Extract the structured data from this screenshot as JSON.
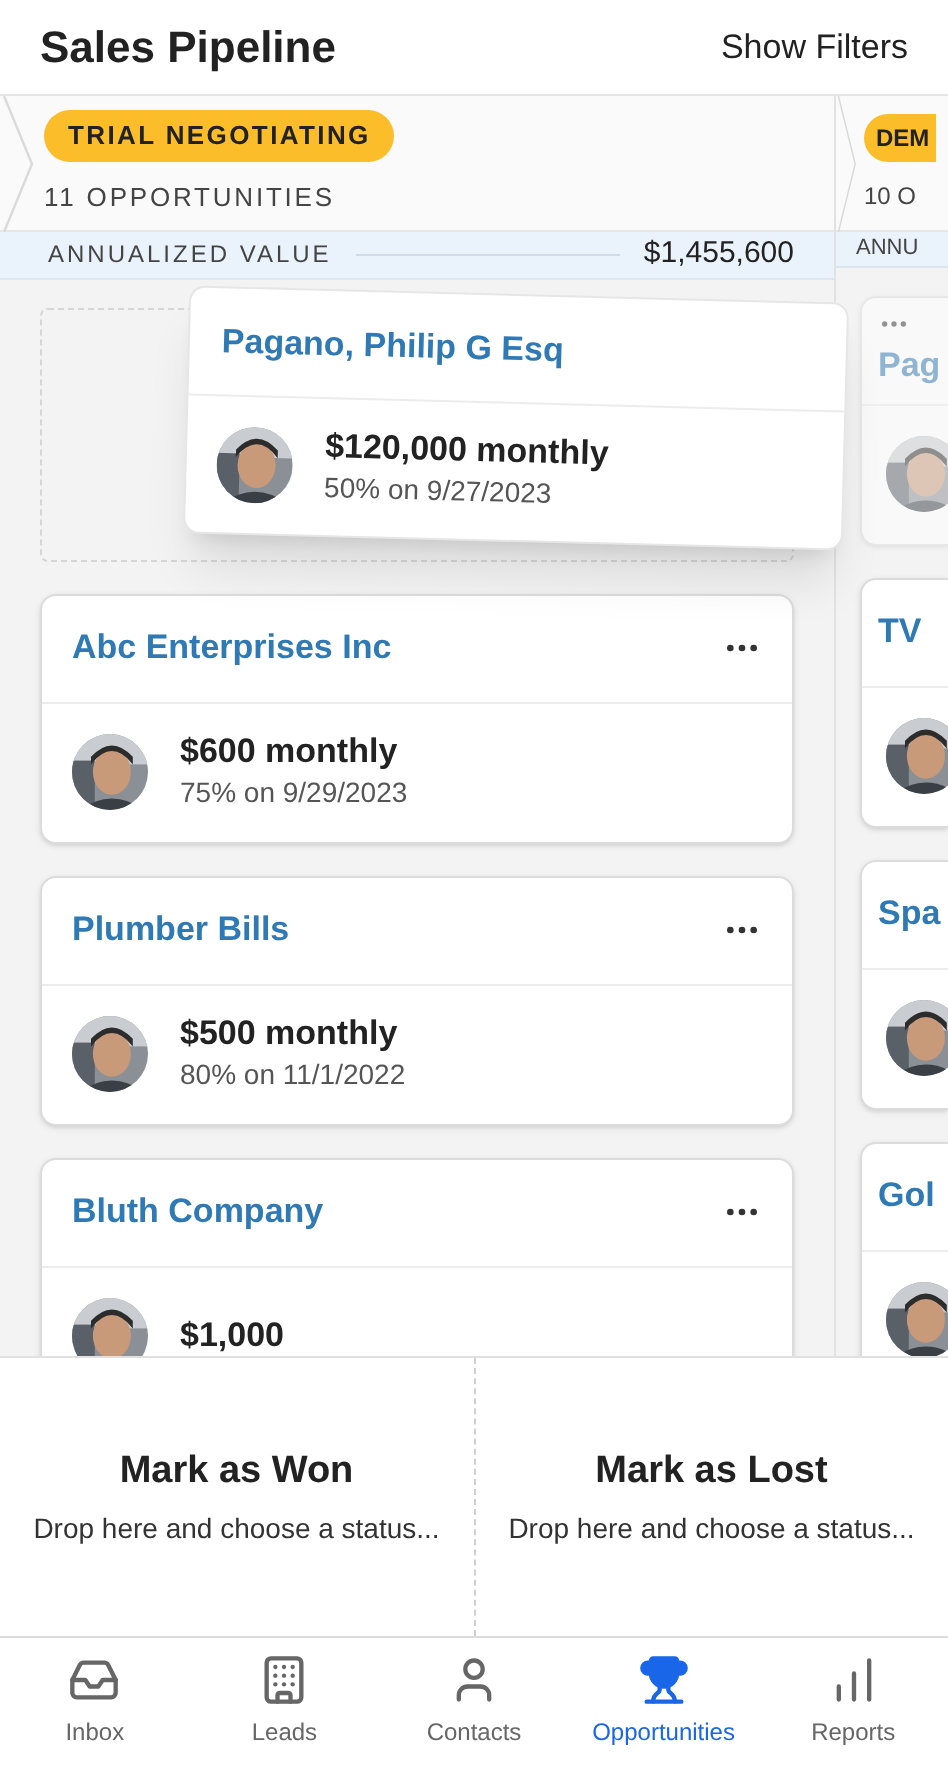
{
  "header": {
    "title": "Sales Pipeline",
    "filter_button": "Show Filters"
  },
  "columns": [
    {
      "stage": "TRIAL NEGOTIATING",
      "count": "11 OPPORTUNITIES",
      "value_label": "ANNUALIZED VALUE",
      "value": "$1,455,600",
      "drop_placeholder": true,
      "cards": [
        {
          "title": "Abc Enterprises Inc",
          "amount": "$600 monthly",
          "probability": "75% on 9/29/2023"
        },
        {
          "title": "Plumber Bills",
          "amount": "$500 monthly",
          "probability": "80% on 11/1/2022"
        },
        {
          "title": "Bluth Company",
          "amount": "$1,000"
        }
      ]
    },
    {
      "stage": "DEM",
      "count": "10 O",
      "value_label": "ANNU",
      "drop_placeholder": false,
      "cards": [
        {
          "title": "Pag",
          "ghost": true
        },
        {
          "title": "TV",
          "ghost": false
        },
        {
          "title": "Spa",
          "ghost": false
        },
        {
          "title": "Gol",
          "ghost": false
        }
      ]
    }
  ],
  "dragged_card": {
    "title": "Pagano, Philip G Esq",
    "amount": "$120,000 monthly",
    "probability": "50% on 9/27/2023"
  },
  "drop_targets": [
    {
      "title": "Mark as Won",
      "hint": "Drop here and choose a status..."
    },
    {
      "title": "Mark as Lost",
      "hint": "Drop here and choose a status..."
    }
  ],
  "tabs": [
    {
      "label": "Inbox",
      "selected": false
    },
    {
      "label": "Leads",
      "selected": false
    },
    {
      "label": "Contacts",
      "selected": false
    },
    {
      "label": "Opportunities",
      "selected": true
    },
    {
      "label": "Reports",
      "selected": false
    }
  ]
}
